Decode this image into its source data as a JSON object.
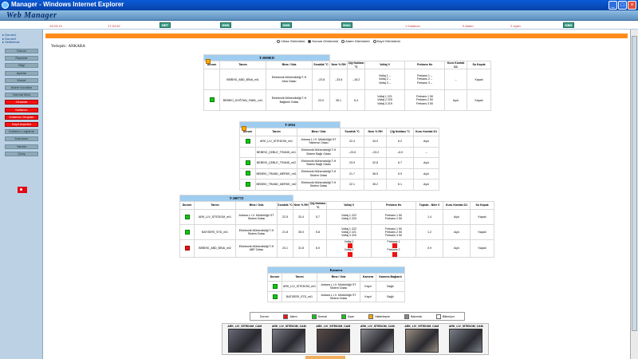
{
  "window": {
    "title": "Manager - Windows Internet Explorer",
    "brand": "Web Manager"
  },
  "infobar": {
    "left_text": "19.03.13",
    "mid_text": "17:34:32",
    "buttons": [
      "NET",
      "SMS",
      "SMS",
      "MAIL",
      "KBN"
    ],
    "t1": "1 Kullanıcı",
    "t2": "0 Alarm",
    "t3": "2 Uyarı"
  },
  "sidebar": {
    "tree": [
      "▸ Durum1",
      "▸ Durum2",
      "▸ Verilerimiz"
    ],
    "buttons": [
      {
        "label": "Durum",
        "color": "gray"
      },
      {
        "label": "Raporlar",
        "color": "gray"
      },
      {
        "label": "Bilgi",
        "color": "gray"
      },
      {
        "label": "Ayarlar",
        "color": "gray"
      },
      {
        "label": "Model",
        "color": "gray"
      },
      {
        "label": "Alarm Kuralları",
        "color": "gray"
      },
      {
        "label": "Normal Mod",
        "color": "gray"
      },
      {
        "label": "Cihazlar",
        "color": "red"
      },
      {
        "label": "Kullanıcı",
        "color": "red"
      },
      {
        "label": "Kullanıcı Grupları",
        "color": "red"
      },
      {
        "label": "Kayıt Arşivleri",
        "color": "red"
      },
      {
        "label": "Kullanıcı Loglama",
        "color": "gray"
      },
      {
        "label": "Dokuman",
        "color": "gray"
      },
      {
        "label": "Yardım",
        "color": "gray"
      },
      {
        "label": "Çıkış",
        "color": "gray"
      }
    ]
  },
  "mode_options": [
    {
      "label": "Cihaz Görünümü",
      "checked": false
    },
    {
      "label": "Konum Görünümü",
      "checked": true
    },
    {
      "label": "Alarm Görünümü",
      "checked": false
    },
    {
      "label": "Kayıt Görünümü",
      "checked": false
    }
  ],
  "location": "Yerleşim : ANKARA",
  "table1": {
    "caption": "T-2000ED",
    "headers": [
      "Durum",
      "Tanım",
      "Bina / Oda",
      "Sıcaklık °C",
      "Nem % RH",
      "Çiğ Noktası °C",
      "Voltaj V",
      "Frekans Hz",
      "Kuru Kontak D1",
      "Su Kaçak"
    ],
    "rows": [
      {
        "status": "orange",
        "name": "BEBEKİ_ABD_BİNA_ml1",
        "location": [
          "Elektronik Mühendisliği T-H",
          "Arka Odası"
        ],
        "temp": "--23.8",
        "hum": "--33.6",
        "dew": "--18.2",
        "volt": [
          "Voltaj 1  --",
          "Voltaj 2  --",
          "Voltaj 3  --"
        ],
        "freq": [
          "Frekans 1  --",
          "Frekans 2  --",
          "Frekans 3  --"
        ],
        "dry": "--",
        "leak": "Kapalı"
      },
      {
        "status": "green",
        "name": "BEBEKİ_DOĞTAN_FABİL_ml1",
        "location": [
          "Elektronik Mühendisliği T-H",
          "Bağlantı Odası"
        ],
        "temp": "23.0",
        "hum": "35.1",
        "dew": "6.4",
        "volt": [
          "Voltaj 1  221",
          "Voltaj 2  220",
          "Voltaj 3  219"
        ],
        "freq": [
          "Frekans 1  50",
          "Frekans 2  50",
          "Frekans 3  50"
        ],
        "dry": "Açık",
        "leak": "Kapalı"
      }
    ]
  },
  "table2": {
    "caption": "T-2004",
    "headers": [
      "Durum",
      "Tanım",
      "Bina / Oda",
      "Sıcaklık °C",
      "Nem % RH",
      "Çiğ Noktası °C",
      "Kuru Kontak D1"
    ],
    "rows": [
      {
        "status": "green",
        "name": "ARK_LIV_SİTEDOM_ml1",
        "location": [
          "Ankara L.I.V. Müdürlüğü ST",
          "Sistemol Odası"
        ],
        "temp": "22.4",
        "hum": "34.0",
        "dew": "6.2",
        "dry": "Açık"
      },
      {
        "status": "orange",
        "name": "BEBEKİ_ÇEBLE_TRAND_ml1",
        "location": [
          "Elektronik Mühendisliği T-H",
          "Sistem Bağlı Odası"
        ],
        "temp": "--23.6",
        "hum": "--33.2",
        "dew": "--6.0",
        "dry": "--"
      },
      {
        "status": "green",
        "name": "BEBEKİ_ÇEBLE_TRAND_ml2",
        "location": [
          "Elektronik Mühendisliği T-H",
          "Sistem Bağlı Odası"
        ],
        "temp": "23.9",
        "hum": "32.8",
        "dew": "6.7",
        "dry": "Açık"
      },
      {
        "status": "green",
        "name": "BEBEKİ_TRAND_MERKE_ml1",
        "location": [
          "Elektronik Mühendisliği T-H",
          "Sistem Odası"
        ],
        "temp": "21.7",
        "hum": "36.5",
        "dew": "5.9",
        "dry": "Açık"
      },
      {
        "status": "green",
        "name": "BEBEKİ_TRAND_MERKE_ml2",
        "location": [
          "Elektronik Mühendisliği T-H",
          "Sistem Odası"
        ],
        "temp": "22.1",
        "hum": "35.2",
        "dew": "6.1",
        "dry": "Açık"
      }
    ]
  },
  "table3": {
    "caption": "T-2007TI",
    "headers": [
      "Durum",
      "Tanım",
      "Bina / Oda",
      "Sıcaklık °C",
      "Nem % RH",
      "Çiğ Noktası °C",
      "Voltaj V",
      "Frekans Hz",
      "Toprak - Nötr V",
      "Kuru Kontak D1",
      "Su Kaçak"
    ],
    "rows": [
      {
        "status": "green",
        "name": "ARK_LIV_SİTEDOM_ml1",
        "location": [
          "Ankara L.I.V. Müdürlüğü ST",
          "Sistem Odası"
        ],
        "temp": "22.5",
        "hum": "33.4",
        "dew": "5.7",
        "volt": [
          "Voltaj 1  222",
          "Voltaj 2  220"
        ],
        "freq": [
          "Frekans 1  50",
          "Frekans 2  50"
        ],
        "tn": "1.4",
        "dry": "Açık",
        "leak": "Kapalı",
        "alarm": false
      },
      {
        "status": "green",
        "name": "BATISERİ_STD_ml1",
        "location": [
          "Elektronik Mühendisliği T-H",
          "Sistem Odası"
        ],
        "temp": "21.8",
        "hum": "35.0",
        "dew": "5.8",
        "volt": [
          "Voltaj 1  222",
          "Voltaj 2  221",
          "Voltaj 3  220"
        ],
        "freq": [
          "Frekans 1  50",
          "Frekans 2  50",
          "Frekans 3  50"
        ],
        "tn": "1.2",
        "dry": "Açık",
        "leak": "Kapalı",
        "alarm": false
      },
      {
        "status": "red",
        "name": "BEBEKİ_ABD_BİNA_ml2",
        "location": [
          "Elektronik Mühendisliği T-H",
          "ABP Odası"
        ],
        "temp": "24.1",
        "hum": "31.8",
        "dew": "6.0",
        "volt": [
          "Voltaj 1",
          "Voltaj 2"
        ],
        "freq": [
          "Frekans 1",
          "Frekans 2"
        ],
        "tn": "0.9",
        "dry": "Açık",
        "leak": "Kapalı",
        "alarm": true
      }
    ]
  },
  "table4": {
    "caption": "Kamera",
    "headers": [
      "Durum",
      "Tanım",
      "Bina / Oda",
      "Kamera",
      "Kamera Bağlantı"
    ],
    "rows": [
      {
        "status": "green",
        "name": "ARK_LIV_SİTEDOM_ml1",
        "location": [
          "Ankara L.I.V. Müdürlüğü ST",
          "Sistem Odası"
        ],
        "cam": "Kayıt",
        "conn": "Bağlı"
      },
      {
        "status": "green",
        "name": "BATISERİ_STD_ml1",
        "location": [
          "Ankara L.I.V. Müdürlüğü ST",
          "Sistem Odası"
        ],
        "cam": "Kayıt",
        "conn": "Bağlı"
      }
    ]
  },
  "legend": [
    {
      "label": "Alarm",
      "color": "#ee1111"
    },
    {
      "label": "Normal",
      "color": "#13c613"
    },
    {
      "label": "Uyarı",
      "color": "#13c613"
    },
    {
      "label": "Haberleşme",
      "color": "#ffaa00"
    },
    {
      "label": "Bakımda",
      "color": "#888888"
    },
    {
      "label": "Bilinmiyor",
      "color": "#ffffff"
    }
  ],
  "legend_prefix": "Durum:",
  "cameras": [
    {
      "label": "ARK_LIV_SİTEDOM_CAM",
      "tone": "#6a6a78"
    },
    {
      "label": "ARK_LIV_SİTEDOM_CAM",
      "tone": "#7c7c88"
    },
    {
      "label": "ARK_LIV_SİTEDOM_CAM",
      "tone": "#5a4a44"
    },
    {
      "label": "ARK_LIV_SİTEDOM_CAM",
      "tone": "#8a8c92"
    },
    {
      "label": "ARK_LIV_SİTEDOM_CAM",
      "tone": "#9a8e82"
    },
    {
      "label": "ARK_LIV_SİTEDOM_CAM",
      "tone": "#7a8088"
    }
  ]
}
